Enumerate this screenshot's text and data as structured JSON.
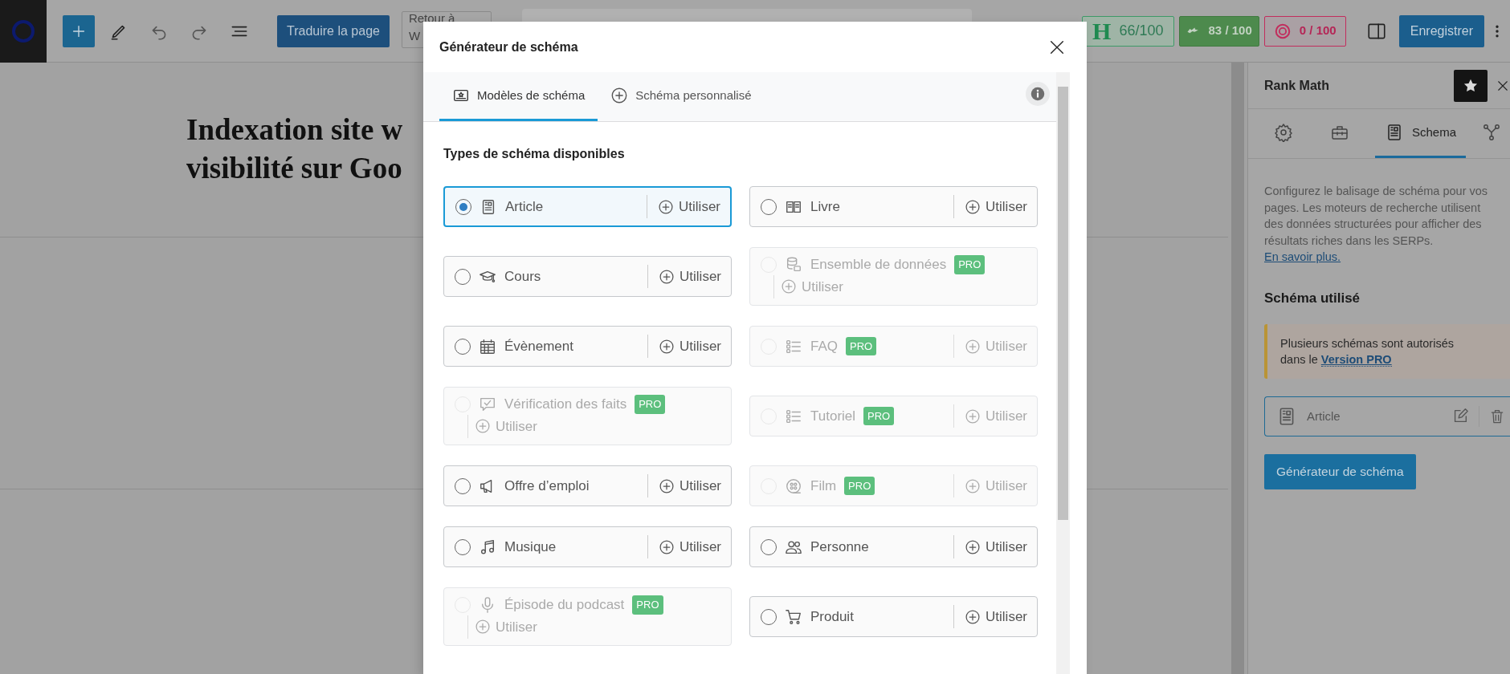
{
  "toolbar": {
    "translate_button": "Traduire la page",
    "back_button": [
      "Retour à",
      "W"
    ],
    "scores": [
      {
        "kind": "headline",
        "icon": "H",
        "label": "66/100"
      },
      {
        "kind": "seo",
        "label": "83 / 100"
      },
      {
        "kind": "ai",
        "label": "0 / 100"
      }
    ],
    "save_button": "Enregistrer"
  },
  "editor": {
    "title_lines": [
      "Indexation site w",
      "visibilité sur Goo"
    ]
  },
  "modal": {
    "title": "Générateur de schéma",
    "tabs": [
      {
        "kind": "templates",
        "label": "Modèles de schéma",
        "selected": true
      },
      {
        "kind": "custom",
        "label": "Schéma personnalisé",
        "selected": false
      }
    ],
    "heading": "Types de schéma disponibles",
    "schemas": [
      {
        "kind": "article",
        "name": "Article",
        "selected": true,
        "disabled": false,
        "action": "Utiliser"
      },
      {
        "kind": "book",
        "name": "Livre",
        "selected": false,
        "disabled": false,
        "action": "Utiliser"
      },
      {
        "kind": "course",
        "name": "Cours",
        "selected": false,
        "disabled": false,
        "action": "Utiliser"
      },
      {
        "kind": "dataset",
        "name": "Ensemble de données",
        "selected": false,
        "disabled": true,
        "badge": "PRO",
        "action": "Utiliser"
      },
      {
        "kind": "event",
        "name": "Évènement",
        "selected": false,
        "disabled": false,
        "action": "Utiliser"
      },
      {
        "kind": "faq",
        "name": "FAQ",
        "selected": false,
        "disabled": true,
        "badge": "PRO",
        "action": "Utiliser"
      },
      {
        "kind": "factcheck",
        "name": "Vérification des faits",
        "selected": false,
        "disabled": true,
        "badge": "PRO",
        "action": "Utiliser"
      },
      {
        "kind": "faq",
        "name": "Tutoriel",
        "selected": false,
        "disabled": true,
        "badge": "PRO",
        "action": "Utiliser"
      },
      {
        "kind": "job",
        "name": "Offre d’emploi",
        "selected": false,
        "disabled": false,
        "action": "Utiliser"
      },
      {
        "kind": "movie",
        "name": "Film",
        "selected": false,
        "disabled": true,
        "badge": "PRO",
        "action": "Utiliser"
      },
      {
        "kind": "music",
        "name": "Musique",
        "selected": false,
        "disabled": false,
        "action": "Utiliser"
      },
      {
        "kind": "person",
        "name": "Personne",
        "selected": false,
        "disabled": false,
        "action": "Utiliser"
      },
      {
        "kind": "podcast",
        "name": "Épisode du podcast",
        "selected": false,
        "disabled": true,
        "badge": "PRO",
        "action": "Utiliser"
      },
      {
        "kind": "product",
        "name": "Produit",
        "selected": false,
        "disabled": false,
        "action": "Utiliser"
      }
    ]
  },
  "sidebar": {
    "title": "Rank Math",
    "tabs": [
      {
        "kind": "settings",
        "selected": false
      },
      {
        "kind": "toolbox",
        "selected": false
      },
      {
        "kind": "schema",
        "label": "Schema",
        "selected": true
      },
      {
        "kind": "network",
        "selected": false
      }
    ],
    "description": "Configurez le balisage de schéma pour vos pages. Les moteurs de recherche utilisent des données structurées pour afficher des résultats riches dans les SERPs.",
    "description_link": "En savoir plus.",
    "section_title": "Schéma utilisé",
    "notice": "Plusieurs schémas sont autorisés dans le",
    "notice_link": "Version PRO",
    "used_schema": {
      "kind": "article",
      "name": "Article"
    },
    "generator_button": "Générateur de schéma"
  }
}
